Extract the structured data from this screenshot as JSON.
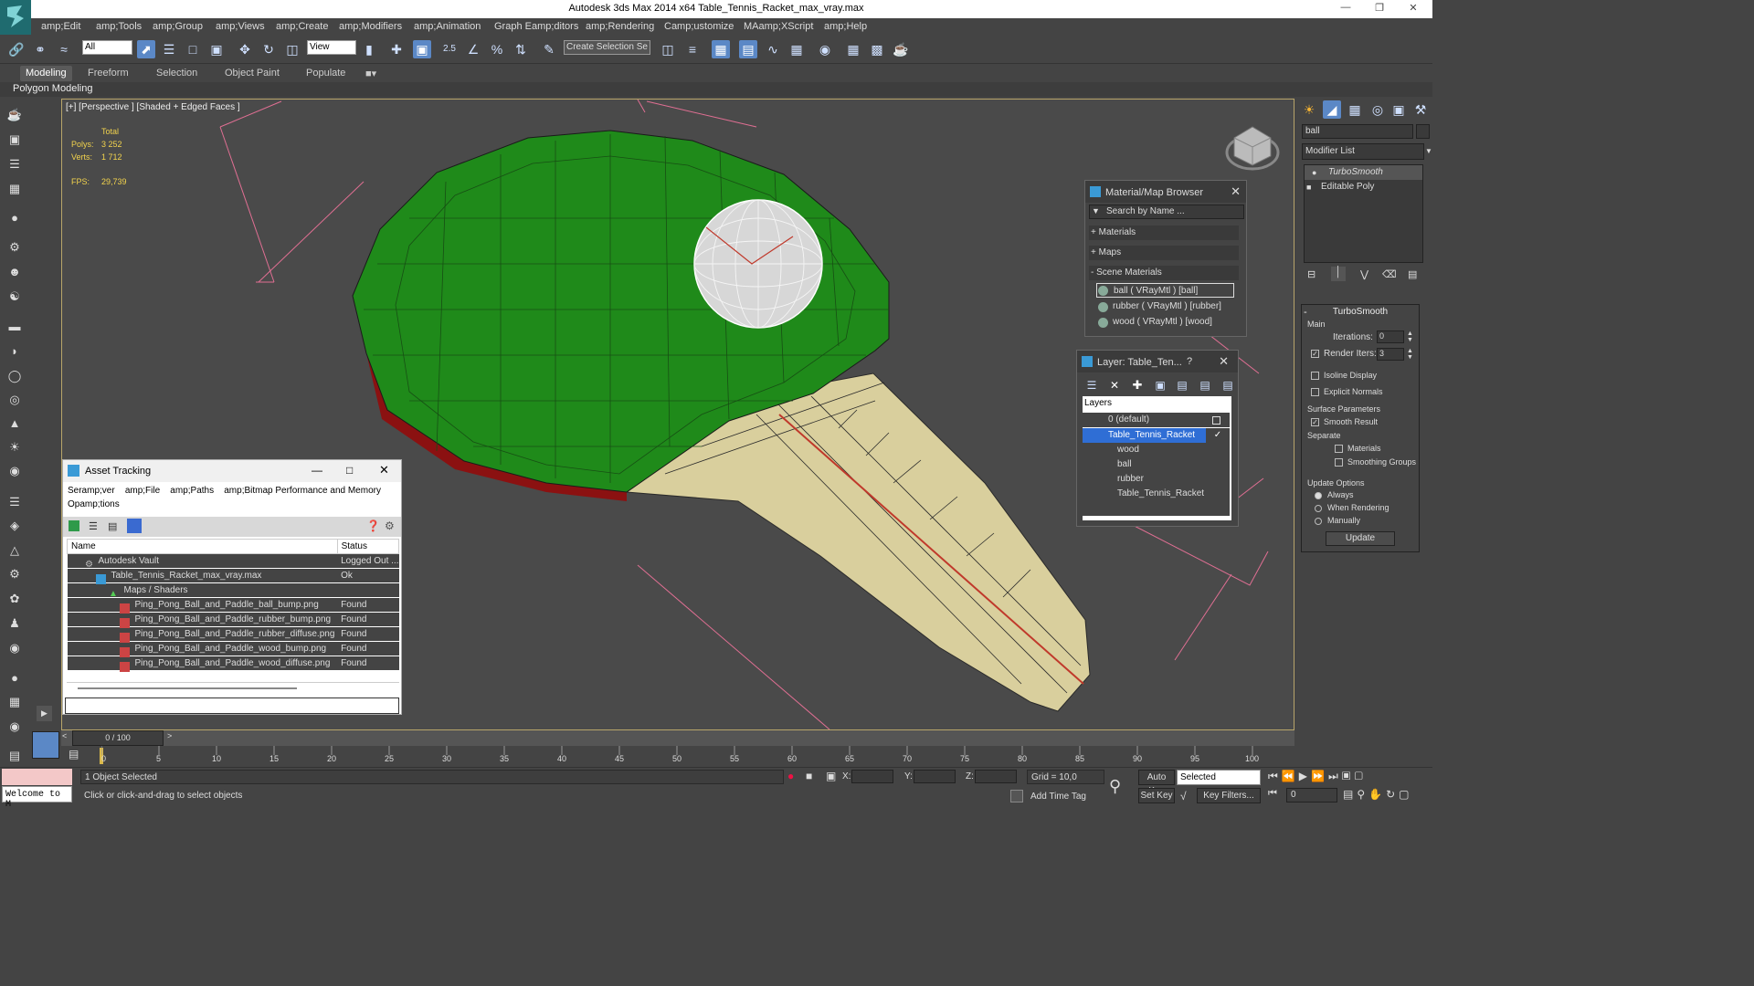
{
  "window": {
    "title": "Autodesk 3ds Max  2014 x64     Table_Tennis_Racket_max_vray.max"
  },
  "menu": [
    "amp;Edit",
    "amp;Tools",
    "amp;Group",
    "amp;Views",
    "amp;Create",
    "amp;Modifiers",
    "amp;Animation",
    "Graph Eamp;ditors",
    "amp;Rendering",
    "Camp;ustomize",
    "MAamp;XScript",
    "amp;Help"
  ],
  "toolbar": {
    "selection_filter": "All",
    "ref_coord": "View",
    "named_selection": "Create Selection Se",
    "snap_angle": "2.5"
  },
  "ribbon": {
    "tabs": [
      "Modeling",
      "Freeform",
      "Selection",
      "Object Paint",
      "Populate"
    ],
    "sub": "Polygon Modeling"
  },
  "viewport": {
    "label": "[+] [Perspective ] [Shaded + Edged Faces ]",
    "stats": {
      "total": "Total",
      "polys_label": "Polys:",
      "polys": "3 252",
      "verts_label": "Verts:",
      "verts": "1 712",
      "fps_label": "FPS:",
      "fps": "29,739"
    }
  },
  "material_browser": {
    "title": "Material/Map Browser",
    "search_placeholder": "Search by Name ...",
    "groups": [
      "+ Materials",
      "+ Maps",
      "- Scene Materials"
    ],
    "materials": [
      "ball  ( VRayMtl )  [ball]",
      "rubber  ( VRayMtl )  [rubber]",
      "wood  ( VRayMtl )  [wood]"
    ]
  },
  "layer_window": {
    "title": "Layer: Table_Ten...",
    "help": "?",
    "header": "Layers",
    "layers": [
      "0 (default)",
      "Table_Tennis_Racket"
    ],
    "children": [
      "wood",
      "ball",
      "rubber",
      "Table_Tennis_Racket"
    ]
  },
  "asset_tracking": {
    "title": "Asset Tracking",
    "menu": [
      "Seramp;ver",
      "amp;File",
      "amp;Paths",
      "amp;Bitmap Performance and Memory",
      "Opamp;tions"
    ],
    "columns": [
      "Name",
      "Status"
    ],
    "rows": [
      {
        "name": "Autodesk Vault",
        "status": "Logged Out ..."
      },
      {
        "name": "Table_Tennis_Racket_max_vray.max",
        "status": "Ok"
      },
      {
        "name": "Maps / Shaders",
        "status": ""
      },
      {
        "name": "Ping_Pong_Ball_and_Paddle_ball_bump.png",
        "status": "Found"
      },
      {
        "name": "Ping_Pong_Ball_and_Paddle_rubber_bump.png",
        "status": "Found"
      },
      {
        "name": "Ping_Pong_Ball_and_Paddle_rubber_diffuse.png",
        "status": "Found"
      },
      {
        "name": "Ping_Pong_Ball_and_Paddle_wood_bump.png",
        "status": "Found"
      },
      {
        "name": "Ping_Pong_Ball_and_Paddle_wood_diffuse.png",
        "status": "Found"
      }
    ]
  },
  "command_panel": {
    "object_name": "ball",
    "modifier_list": "Modifier List",
    "stack": [
      "TurboSmooth",
      "Editable Poly"
    ],
    "rollout": "TurboSmooth",
    "main_label": "Main",
    "iterations_label": "Iterations:",
    "iterations": "0",
    "render_iters_label": "Render Iters:",
    "render_iters": "3",
    "isoline": "Isoline Display",
    "explicit": "Explicit Normals",
    "surface_params": "Surface Parameters",
    "smooth_result": "Smooth Result",
    "separate": "Separate",
    "sep_materials": "Materials",
    "sep_smoothing": "Smoothing Groups",
    "update_options": "Update Options",
    "opt_always": "Always",
    "opt_render": "When Rendering",
    "opt_manual": "Manually",
    "update_btn": "Update"
  },
  "timeline": {
    "frame": "0 / 100",
    "ticks": [
      "0",
      "5",
      "10",
      "15",
      "20",
      "25",
      "30",
      "35",
      "40",
      "45",
      "50",
      "55",
      "60",
      "65",
      "70",
      "75",
      "80",
      "85",
      "90",
      "95",
      "100"
    ]
  },
  "status": {
    "maxscript": "Welcome to M",
    "selected": "1 Object Selected",
    "prompt": "Click or click-and-drag to select objects",
    "x_label": "X:",
    "y_label": "Y:",
    "z_label": "Z:",
    "grid": "Grid = 10,0",
    "add_time_tag": "Add Time Tag",
    "auto_key": "Auto Key",
    "selected_dd": "Selected",
    "set_key": "Set Key",
    "key_filters": "Key Filters...",
    "frame_field": "0"
  }
}
